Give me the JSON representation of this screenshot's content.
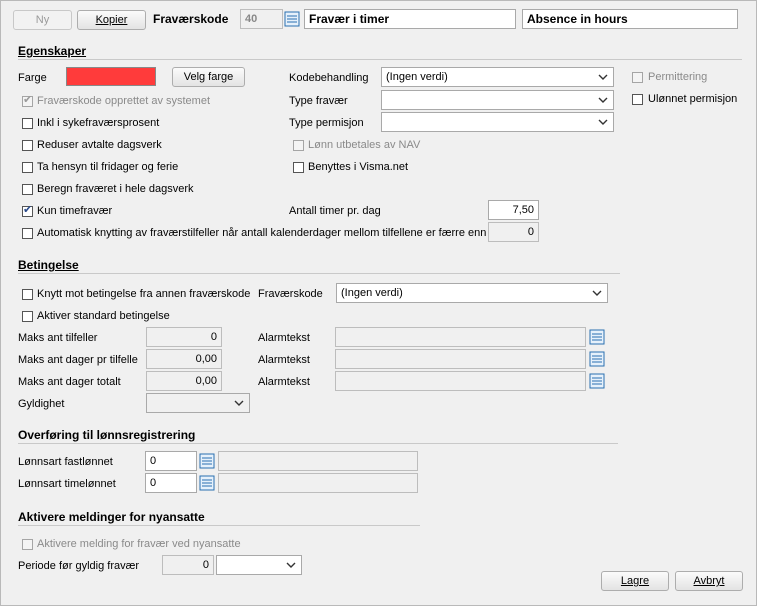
{
  "toolbar": {
    "new_label": "Ny",
    "copy_label": "Kopier",
    "code_label": "Fraværskode",
    "code_value": "40",
    "name_no": "Fravær i timer",
    "name_en": "Absence in hours"
  },
  "properties": {
    "section_title": "Egenskaper",
    "color_label": "Farge",
    "color_value": "#ff3b3b",
    "choose_color_label": "Velg farge",
    "system_created_label": "Fraværskode opprettet av systemet",
    "include_sick_label": "Inkl i sykefraværsprosent",
    "reduce_workday_label": "Reduser avtalte dagsverk",
    "holidays_label": "Ta hensyn til fridager og ferie",
    "full_day_label": "Beregn fraværet i hele dagsverk",
    "hourly_only_label": "Kun timefravær",
    "auto_link_label": "Automatisk knytting av fraværstilfeller når antall kalenderdager mellom tilfellene er færre enn",
    "auto_link_value": "0",
    "code_handling_label": "Kodebehandling",
    "code_handling_value": "(Ingen verdi)",
    "absence_type_label": "Type fravær",
    "absence_type_value": "",
    "leave_type_label": "Type permisjon",
    "leave_type_value": "",
    "nav_pay_label": "Lønn utbetales av NAV",
    "visma_label": "Benyttes i Visma.net",
    "hours_per_day_label": "Antall timer pr. dag",
    "hours_per_day_value": "7,50",
    "layoff_label": "Permittering",
    "unpaid_leave_label": "Ulønnet permisjon"
  },
  "condition": {
    "section_title": "Betingelse",
    "link_other_label": "Knytt mot betingelse fra annen fraværskode",
    "code_label": "Fraværskode",
    "code_value": "(Ingen verdi)",
    "activate_std_label": "Aktiver standard betingelse",
    "max_cases_label": "Maks ant tilfeller",
    "max_cases_value": "0",
    "max_days_per_case_label": "Maks ant dager pr tilfelle",
    "max_days_per_case_value": "0,00",
    "max_days_total_label": "Maks ant dager totalt",
    "max_days_total_value": "0,00",
    "alarm_label": "Alarmtekst",
    "validity_label": "Gyldighet",
    "validity_value": ""
  },
  "payroll": {
    "section_title": "Overføring til lønnsregistrering",
    "fixed_label": "Lønnsart fastlønnet",
    "fixed_value": "0",
    "hourly_label": "Lønnsart timelønnet",
    "hourly_value": "0"
  },
  "newhire": {
    "section_title": "Aktivere meldinger for nyansatte",
    "activate_label": "Aktivere melding for fravær ved nyansatte",
    "period_label": "Periode før gyldig fravær",
    "period_value": "0",
    "period_unit": ""
  },
  "footer": {
    "save_label": "Lagre",
    "cancel_label": "Avbryt"
  }
}
